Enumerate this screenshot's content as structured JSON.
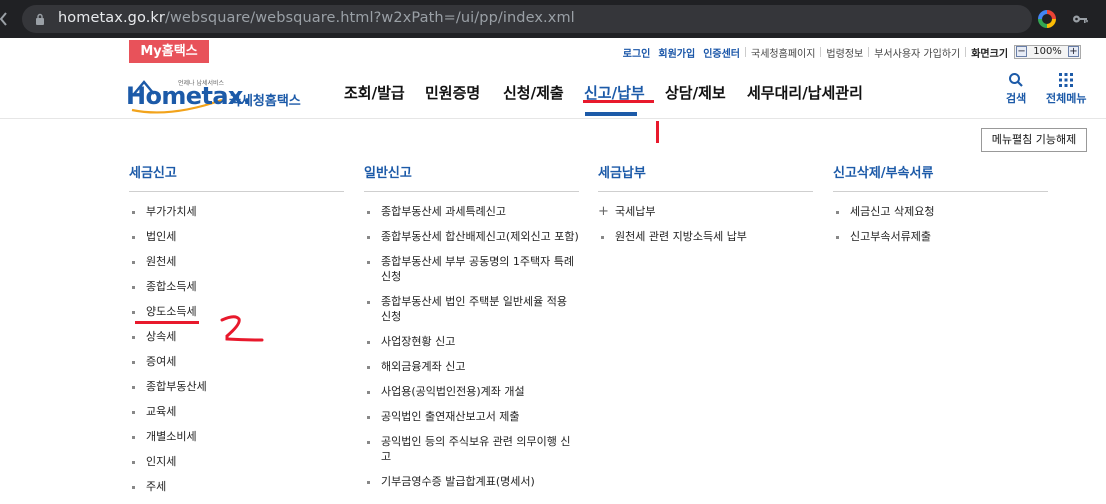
{
  "browser": {
    "url_host": "hometax.go.kr",
    "url_path": "/websquare/websquare.html?w2xPath=/ui/pp/index.xml"
  },
  "topbar": {
    "my_tab": "My홈택스",
    "links": [
      "로그인",
      "회원가입",
      "인증센터",
      "국세청홈페이지",
      "법령정보",
      "부서사용자 가입하기",
      "화면크기"
    ],
    "zoom": "100%",
    "zoom_minus": "−",
    "zoom_plus": "+"
  },
  "logo": {
    "small_text": "언제나 납세서비스",
    "main_text": "Hometax.",
    "sub_text": "국세청홈택스"
  },
  "gnb": {
    "items": [
      "조회/발급",
      "민원증명",
      "신청/제출",
      "신고/납부",
      "상담/제보",
      "세무대리/납세관리"
    ],
    "active_index": 3
  },
  "header_icons": {
    "search": "검색",
    "all_menu": "전체메뉴"
  },
  "fold_button": "메뉴펼침 기능해제",
  "columns": [
    {
      "title": "세금신고",
      "items": [
        "부가가치세",
        "법인세",
        "원천세",
        "종합소득세",
        "양도소득세",
        "상속세",
        "증여세",
        "종합부동산세",
        "교육세",
        "개별소비세",
        "인지세",
        "주세"
      ]
    },
    {
      "title": "일반신고",
      "items": [
        "종합부동산세 과세특례신고",
        "종합부동산세 합산배제신고(제외신고 포함)",
        "종합부동산세 부부 공동명의 1주택자 특례 신청",
        "종합부동산세 법인 주택분 일반세율 적용 신청",
        "사업장현황 신고",
        "해외금융계좌 신고",
        "사업용(공익법인전용)계좌 개설",
        "공익법인 출연재산보고서 제출",
        "공익법인 등의 주식보유 관련 의무이행 신고",
        "기부금영수증 발급합계표(명세서)"
      ]
    },
    {
      "title": "세금납부",
      "items": [
        "국세납부",
        "원천세 관련 지방소득세 납부"
      ]
    },
    {
      "title": "신고삭제/부속서류",
      "items": [
        "세금신고 삭제요청",
        "신고부속서류제출"
      ]
    }
  ],
  "colors": {
    "brand_blue": "#1c5aa8",
    "my_tab_red": "#e8525a",
    "annotation_red": "#e8192c"
  }
}
